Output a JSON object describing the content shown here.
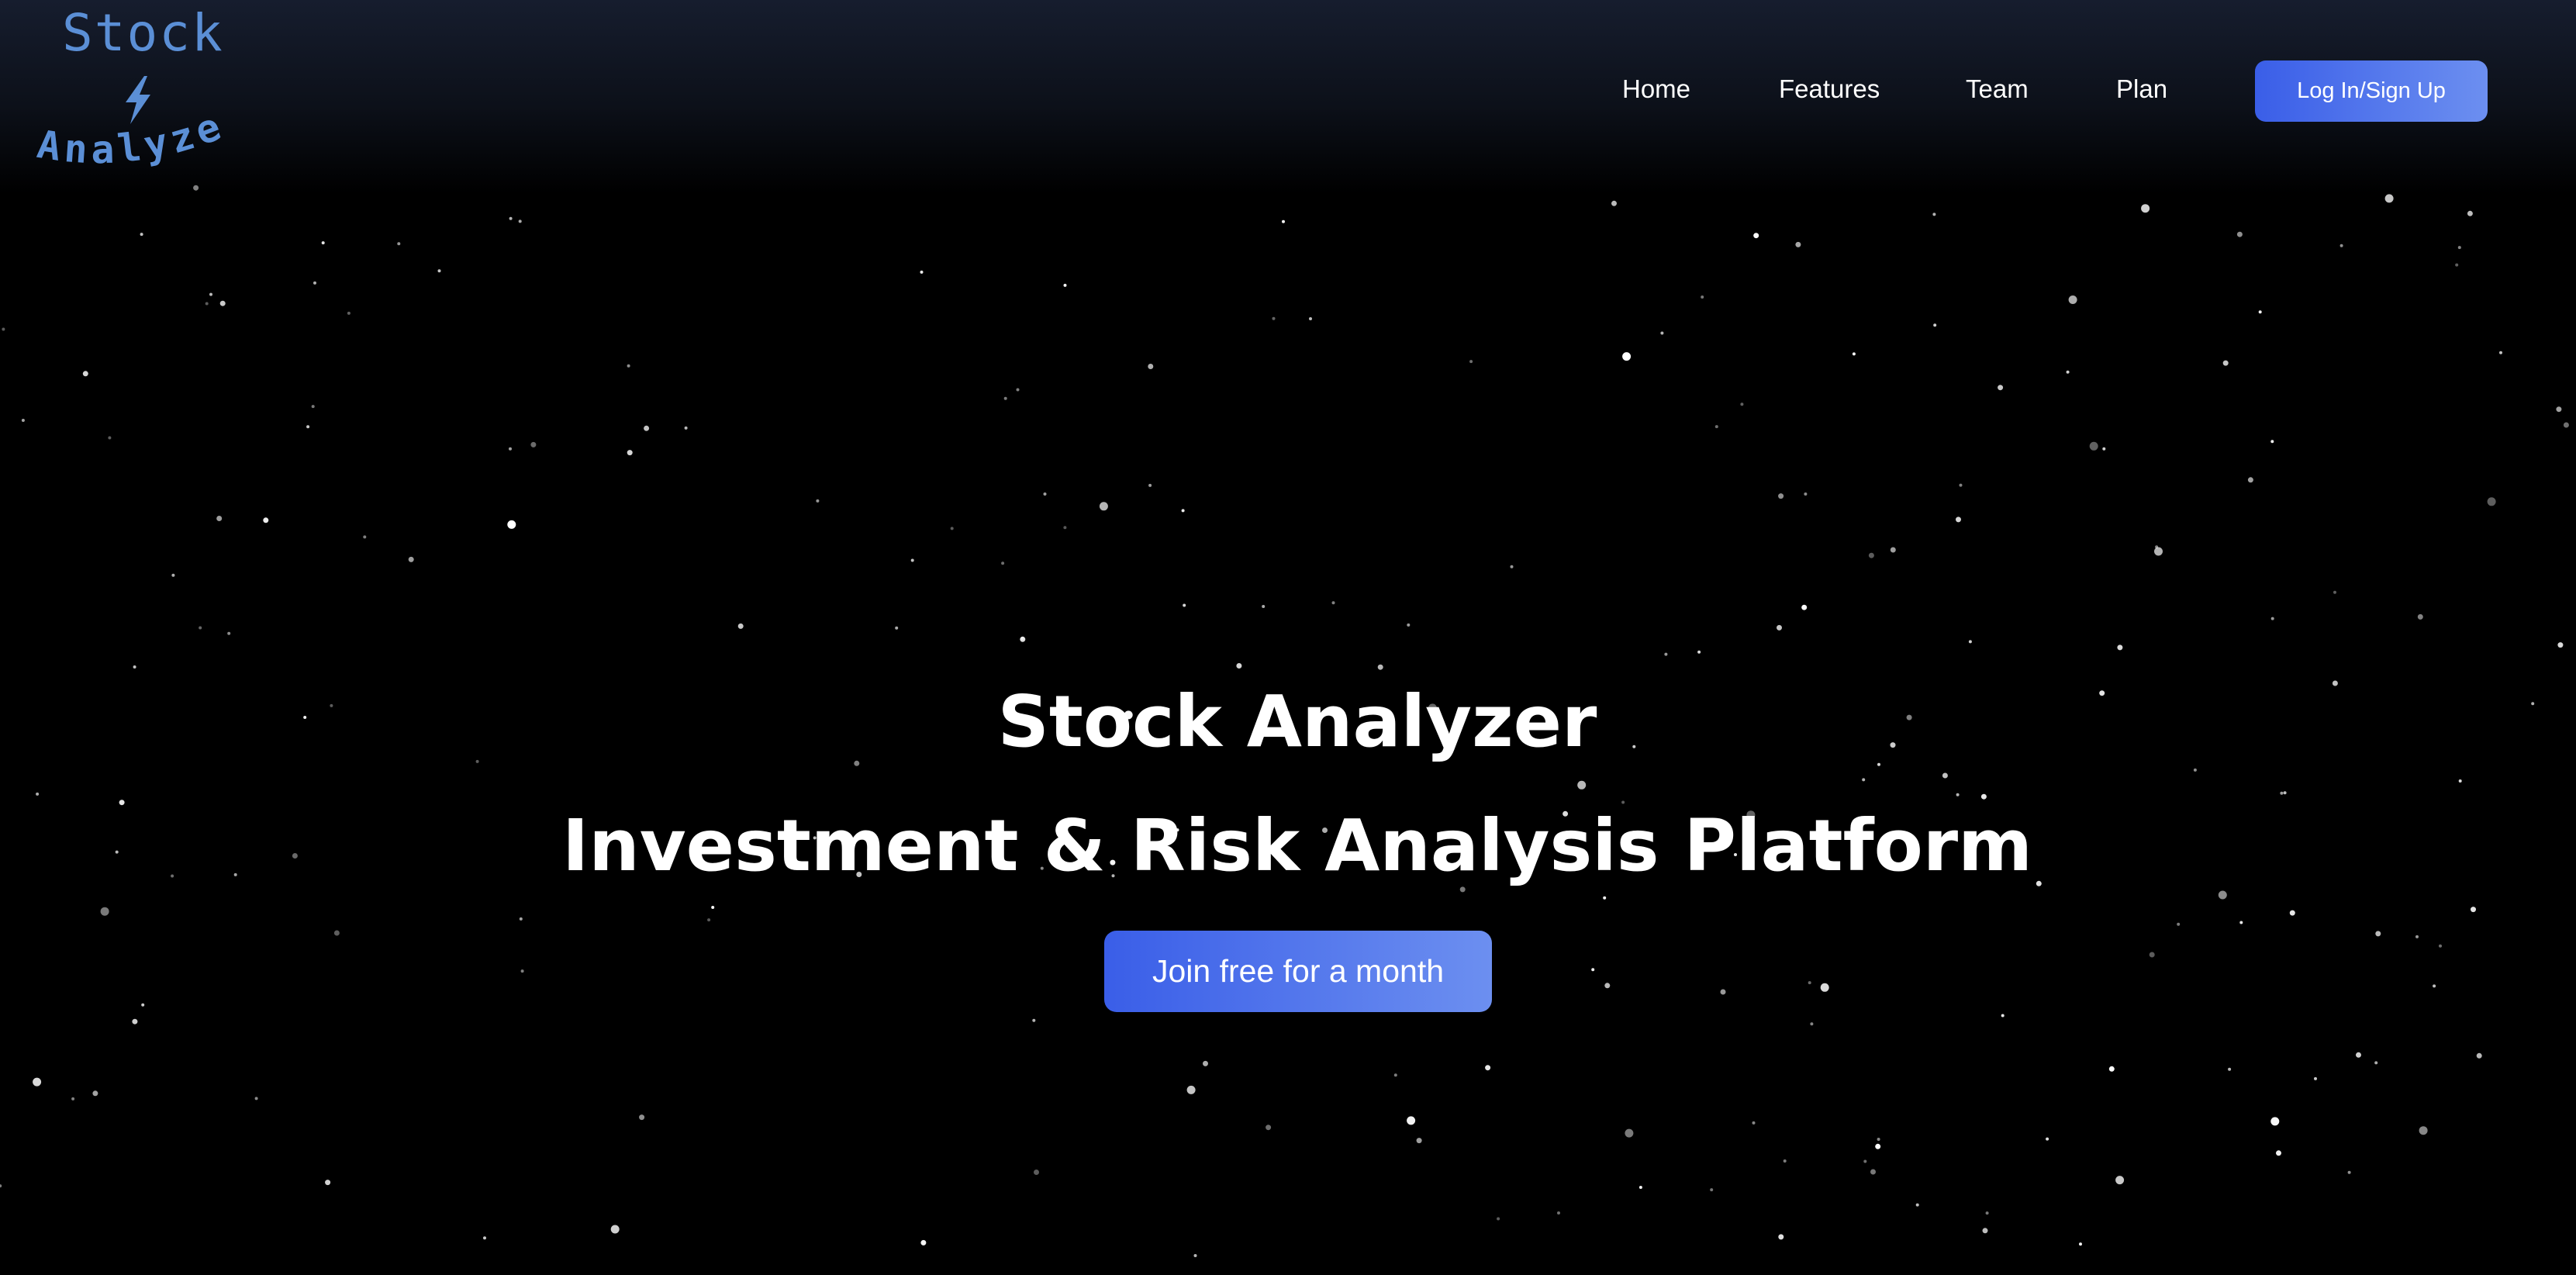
{
  "brand": {
    "logo_top": "Stock",
    "logo_bottom": "Analyzer",
    "logo_icon": "lightning-bolt-icon",
    "logo_color": "#5b8fd6"
  },
  "nav": {
    "items": [
      {
        "label": "Home"
      },
      {
        "label": "Features"
      },
      {
        "label": "Team"
      },
      {
        "label": "Plan"
      }
    ],
    "cta_label": "Log In/Sign Up"
  },
  "hero": {
    "title": "Stock Analyzer",
    "subtitle": "Investment & Risk Analysis Platform",
    "cta_label": "Join free for a month"
  },
  "colors": {
    "background": "#000000",
    "header_top": "#161d2e",
    "accent_start": "#3a5ee8",
    "accent_end": "#6c8ff0",
    "text": "#ffffff"
  }
}
